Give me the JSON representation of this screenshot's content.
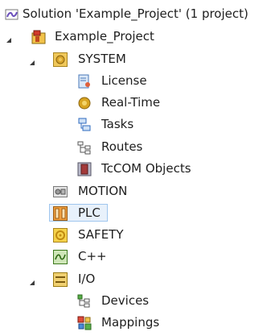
{
  "solution_explorer": {
    "nodes": [
      {
        "id": "solution",
        "label": "Solution 'Example_Project' (1 project)",
        "icon": "solution-icon",
        "expanded": null
      },
      {
        "id": "project",
        "label": "Example_Project",
        "icon": "project-icon",
        "expanded": true
      },
      {
        "id": "system",
        "label": "SYSTEM",
        "icon": "system-gear-icon",
        "expanded": true
      },
      {
        "id": "license",
        "label": "License",
        "icon": "license-icon",
        "expanded": null
      },
      {
        "id": "realtime",
        "label": "Real-Time",
        "icon": "realtime-icon",
        "expanded": null
      },
      {
        "id": "tasks",
        "label": "Tasks",
        "icon": "tasks-icon",
        "expanded": null
      },
      {
        "id": "routes",
        "label": "Routes",
        "icon": "routes-icon",
        "expanded": null
      },
      {
        "id": "tccom",
        "label": "TcCOM Objects",
        "icon": "tccom-icon",
        "expanded": null
      },
      {
        "id": "motion",
        "label": "MOTION",
        "icon": "motion-icon",
        "expanded": null
      },
      {
        "id": "plc",
        "label": "PLC",
        "icon": "plc-icon",
        "expanded": null,
        "selected": true
      },
      {
        "id": "safety",
        "label": "SAFETY",
        "icon": "safety-icon",
        "expanded": null
      },
      {
        "id": "cpp",
        "label": "C++",
        "icon": "cpp-icon",
        "expanded": null
      },
      {
        "id": "io",
        "label": "I/O",
        "icon": "io-icon",
        "expanded": true
      },
      {
        "id": "devices",
        "label": "Devices",
        "icon": "devices-icon",
        "expanded": null
      },
      {
        "id": "mappings",
        "label": "Mappings",
        "icon": "mappings-icon",
        "expanded": null
      }
    ]
  },
  "colors": {
    "selection_bg": "#e8f1fb",
    "selection_border": "#9fc6ee",
    "text": "#1e1e1e",
    "expander": "#3c3c3c"
  }
}
